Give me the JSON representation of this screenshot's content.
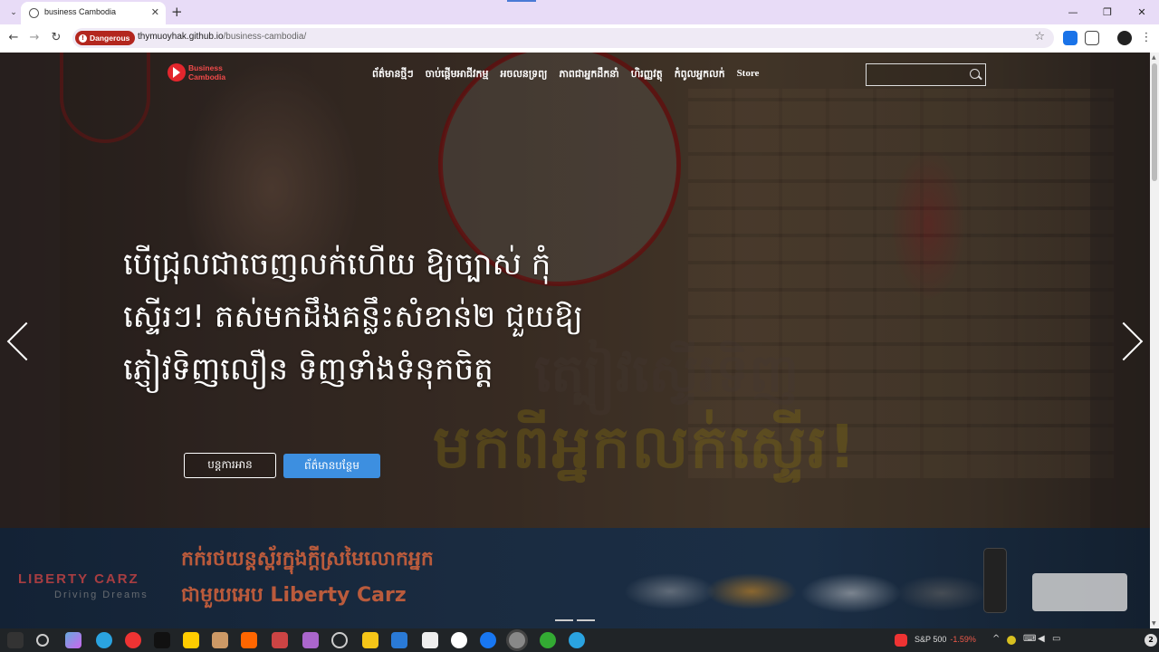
{
  "browser": {
    "tab_title": "business Cambodia",
    "tab_list_glyph": "⌄",
    "tab_close": "✕",
    "new_tab": "+",
    "window_controls": [
      "—",
      "❐",
      "✕"
    ],
    "security_label": "Dangerous",
    "url_host": "thymuoyhak.github.io",
    "url_path": "/business-cambodia/",
    "bookmark_glyph": "☆",
    "nav_glyphs": {
      "back": "←",
      "forward": "→",
      "reload": "↻",
      "menu": "⋮"
    }
  },
  "site": {
    "logo_line1": "Business",
    "logo_line2": "Cambodia",
    "nav": [
      "ព័ត៌មានថ្មីៗ",
      "ចាប់ផ្តើមអាជីវកម្ម",
      "អចលនទ្រព្យ",
      "ភាពជាអ្នកដឹកនាំ",
      "ហិរញ្ញវត្ថុ",
      "កំពូលអ្នកលក់",
      "Store"
    ],
    "search_placeholder": ""
  },
  "hero": {
    "headline_line1": "បើជ្រុលជាចេញលក់ហើយ ឱ្យច្បាស់ កុំ",
    "headline_line2": "ស្ទើរៗ! តស់មកដឹងគន្លឹះសំខាន់២ ជួយឱ្យ",
    "headline_line3": "ភ្ញៀវទិញលឿន ទិញទាំងទំនុកចិត្ត",
    "button_read": "បន្តការអាន",
    "button_more": "ព័ត៌មានបន្ថែម",
    "bg_caption1": "ត្បៀវស្ទើរទិញ",
    "bg_caption2": "មកពីអ្នកលក់ស្ទើរ!"
  },
  "banner": {
    "brand": "LIBERTY CARZ",
    "brand_sub": "Driving Dreams",
    "line1": "កក់រថយន្តស្ព័រក្នុងក្ដីស្រមៃលោកអ្នក",
    "line2": "ជាមួយអេប Liberty Carz"
  },
  "taskbar": {
    "stock_name": "S&P 500",
    "stock_change": "-1.59%",
    "notification_count": "2"
  },
  "colors": {
    "danger": "#b3261e",
    "primary_button": "#3d8fe0",
    "logo_red": "#e3262d",
    "tabbar": "#e8dcf7"
  }
}
